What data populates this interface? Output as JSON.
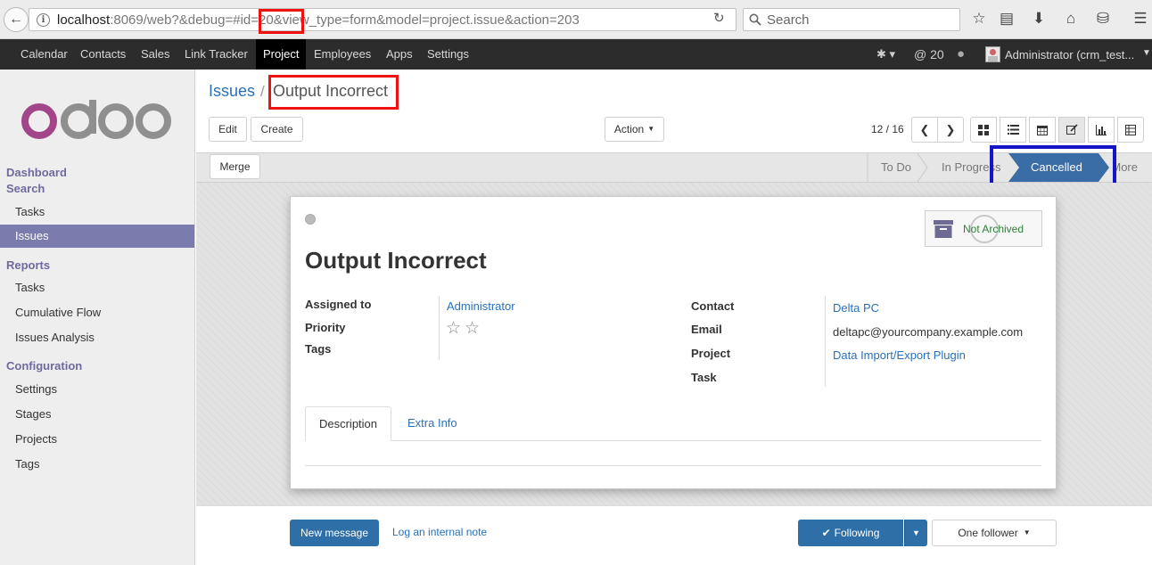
{
  "browser": {
    "url_host": "localhost",
    "url_rest": ":8069/web?&debug=#id=20&view_type=form&model=project.issue&action=203",
    "search_placeholder": "Search"
  },
  "topnav": {
    "menus": [
      "Calendar",
      "Contacts",
      "Sales",
      "Link Tracker",
      "Project",
      "Employees",
      "Apps",
      "Settings"
    ],
    "active": "Project",
    "message_count": "@ 20",
    "user": "Administrator (crm_test..."
  },
  "sidebar": {
    "sections": [
      {
        "header": "Dashboard",
        "items": []
      },
      {
        "header": "Search",
        "items": [
          "Tasks",
          "Issues"
        ]
      },
      {
        "header": "Reports",
        "items": [
          "Tasks",
          "Cumulative Flow",
          "Issues Analysis"
        ]
      },
      {
        "header": "Configuration",
        "items": [
          "Settings",
          "Stages",
          "Projects",
          "Tags"
        ]
      }
    ],
    "active_item": "Issues"
  },
  "control_panel": {
    "breadcrumb_parent": "Issues",
    "breadcrumb_sep": "/",
    "breadcrumb_current": "Output Incorrect",
    "edit_label": "Edit",
    "create_label": "Create",
    "action_label": "Action",
    "pager": "12 / 16"
  },
  "statusbar": {
    "merge_label": "Merge",
    "stages": [
      "To Do",
      "In Progress",
      "Cancelled",
      "More"
    ],
    "active_stage": "Cancelled"
  },
  "form": {
    "title": "Output Incorrect",
    "archive_label": "Not Archived",
    "left_fields": [
      {
        "label": "Assigned to",
        "value": "Administrator"
      },
      {
        "label": "Priority",
        "value": ""
      },
      {
        "label": "Tags",
        "value": ""
      }
    ],
    "right_fields": [
      {
        "label": "Contact",
        "value": "Delta PC"
      },
      {
        "label": "Email",
        "value": "deltapc@yourcompany.example.com"
      },
      {
        "label": "Project",
        "value": "Data Import/Export Plugin"
      },
      {
        "label": "Task",
        "value": ""
      }
    ],
    "priority_stars": 0,
    "priority_max": 2,
    "tabs": [
      "Description",
      "Extra Info"
    ],
    "active_tab": "Description"
  },
  "chatter": {
    "new_message": "New message",
    "log_note": "Log an internal note",
    "following": "Following",
    "followers": "One follower"
  },
  "colors": {
    "nav_bg": "#2c2c2c",
    "sidebar_active": "#7c7bad",
    "link": "#2a70b8",
    "primary_btn": "#2f6fa7",
    "stage_active": "#3a6ca5"
  }
}
